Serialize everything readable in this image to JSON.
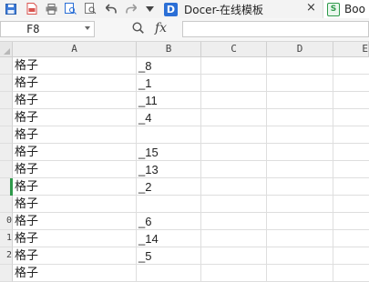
{
  "toolbar": {
    "icons": [
      "save-icon",
      "export-pdf-icon",
      "print-icon",
      "print-preview-icon",
      "find-icon",
      "undo-icon",
      "redo-icon",
      "more-dropdown-icon"
    ],
    "doc_tab": {
      "logo": "D",
      "label": "Docer-在线模板",
      "close": "×"
    },
    "book_tab": {
      "label": "Boo"
    }
  },
  "formula_bar": {
    "cell_ref": "F8",
    "zoom_icon": "magnifier-icon",
    "fx_label": "fx",
    "formula": ""
  },
  "columns": [
    "A",
    "B",
    "C",
    "D",
    "E"
  ],
  "rows": [
    {
      "num": "",
      "a": "格子",
      "b": "_8"
    },
    {
      "num": "",
      "a": "格子",
      "b": "_1"
    },
    {
      "num": "",
      "a": "格子",
      "b": "_11"
    },
    {
      "num": "",
      "a": "格子",
      "b": "_4"
    },
    {
      "num": "",
      "a": "格子",
      "b": ""
    },
    {
      "num": "",
      "a": "格子",
      "b": "_15"
    },
    {
      "num": "",
      "a": "格子",
      "b": "_13"
    },
    {
      "num": "",
      "a": "格子",
      "b": "_2"
    },
    {
      "num": "",
      "a": "格子",
      "b": ""
    },
    {
      "num": "0",
      "a": "格子",
      "b": "_6"
    },
    {
      "num": "1",
      "a": "格子",
      "b": "_14"
    },
    {
      "num": "2",
      "a": "格子",
      "b": "_5"
    },
    {
      "num": "",
      "a": "格子",
      "b": ""
    }
  ],
  "colors": {
    "accent": "#2b6fd6",
    "selected_row_marker": "#2f9a4b"
  }
}
